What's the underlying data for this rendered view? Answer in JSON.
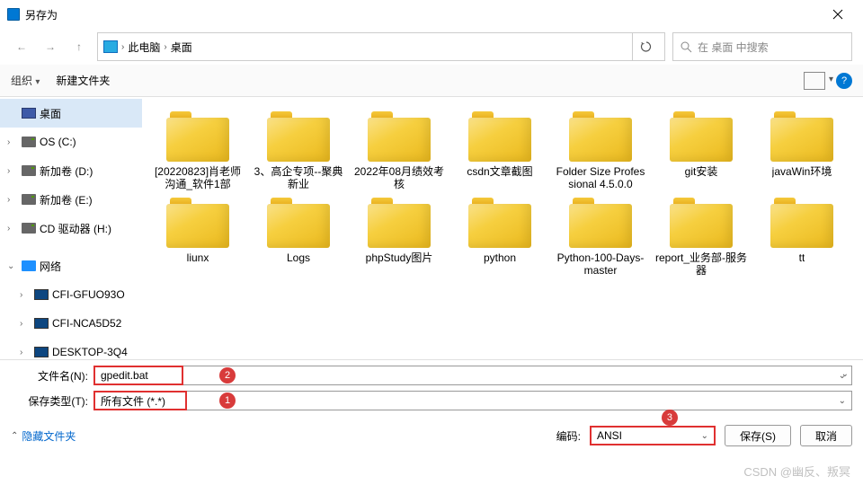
{
  "title": "另存为",
  "breadcrumb": {
    "pc": "此电脑",
    "folder": "桌面"
  },
  "search_placeholder": "在 桌面 中搜索",
  "toolbar": {
    "organize": "组织",
    "newfolder": "新建文件夹"
  },
  "tree": [
    {
      "label": "桌面",
      "sel": true,
      "icon": "desk",
      "exp": ""
    },
    {
      "label": "OS (C:)",
      "icon": "drive",
      "exp": "›"
    },
    {
      "label": "新加卷 (D:)",
      "icon": "drive",
      "exp": "›"
    },
    {
      "label": "新加卷 (E:)",
      "icon": "drive",
      "exp": "›"
    },
    {
      "label": "CD 驱动器 (H:)",
      "icon": "drive",
      "exp": "›"
    },
    {
      "label": "网络",
      "icon": "net",
      "exp": "⌄",
      "indent": 0
    },
    {
      "label": "CFI-GFUO93O",
      "icon": "mon",
      "exp": "›",
      "indent": 1
    },
    {
      "label": "CFI-NCA5D52",
      "icon": "mon",
      "exp": "›",
      "indent": 1
    },
    {
      "label": "DESKTOP-3Q4",
      "icon": "mon",
      "exp": "›",
      "indent": 1
    }
  ],
  "folders": [
    "[20220823]肖老师沟通_软件1部",
    "3、高企专项--聚典新业",
    "2022年08月绩效考核",
    "csdn文章截图",
    "Folder Size Professional 4.5.0.0",
    "git安装",
    "javaWin环境",
    "liunx",
    "Logs",
    "phpStudy图片",
    "python",
    "Python-100-Days-master",
    "report_业务部-服务器",
    "tt"
  ],
  "filename_label": "文件名(N):",
  "filetype_label": "保存类型(T):",
  "filename_value": "gpedit.bat",
  "filetype_value": "所有文件  (*.*)",
  "encoding_label": "编码:",
  "encoding_value": "ANSI",
  "hide_folders": "隐藏文件夹",
  "save_btn": "保存(S)",
  "cancel_btn": "取消",
  "badges": {
    "b1": "1",
    "b2": "2",
    "b3": "3"
  },
  "watermark": "CSDN @幽反、叛冥"
}
